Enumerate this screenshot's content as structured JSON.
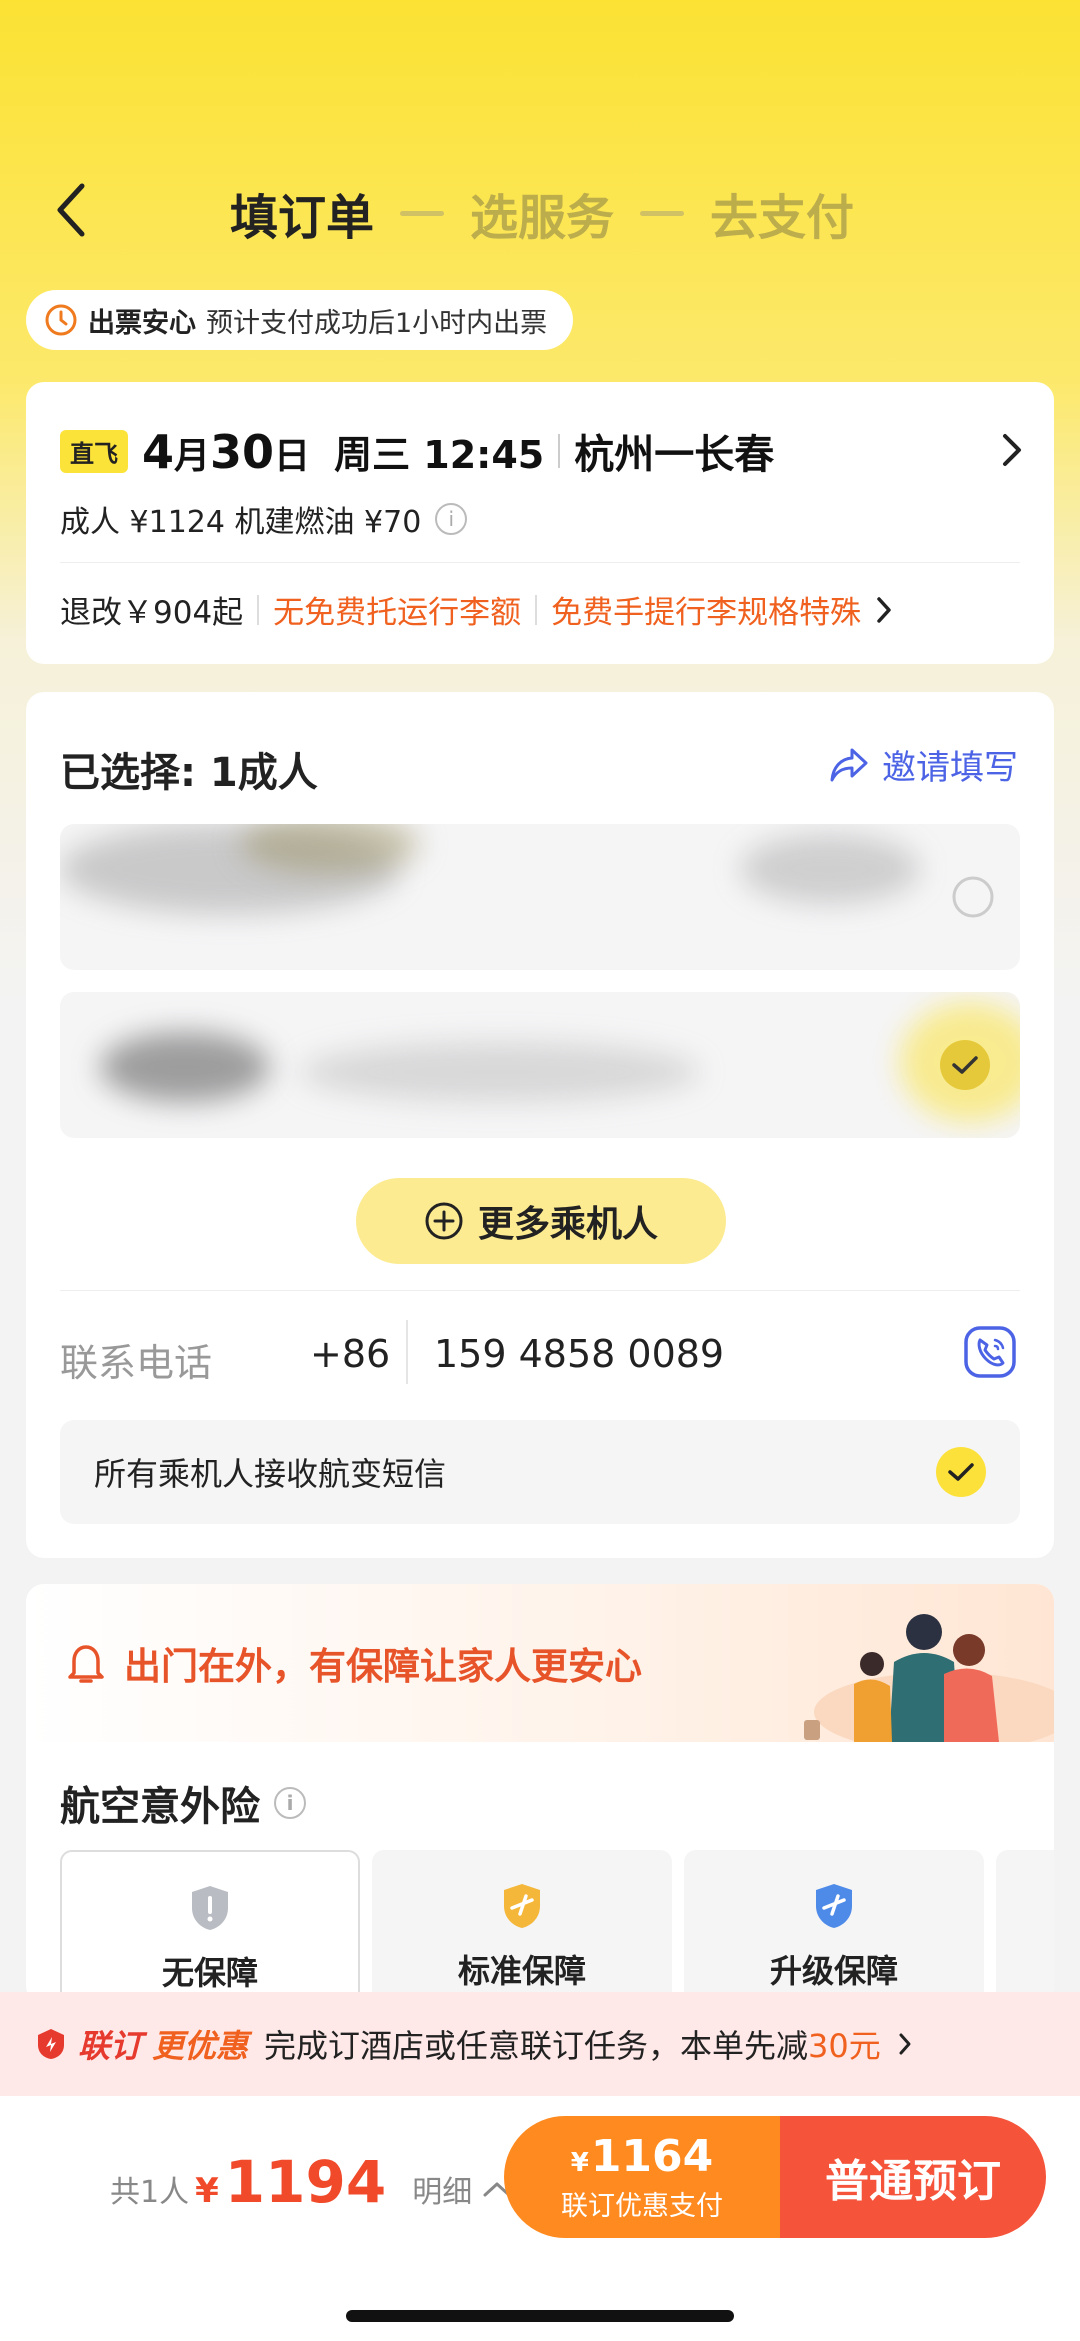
{
  "header": {
    "steps": [
      "填订单",
      "选服务",
      "去支付"
    ]
  },
  "notice": {
    "title": "出票安心",
    "text": "预计支付成功后1小时内出票"
  },
  "flight": {
    "badge": "直飞",
    "month": "4",
    "month_unit": "月",
    "day": "30",
    "day_unit": "日",
    "weekday_time": "周三 12:45",
    "route": "杭州一长春",
    "price_line": "成人 ¥1124 机建燃油 ¥70",
    "policy_refund": "退改￥904起",
    "policy_baggage": "无免费托运行李额",
    "policy_carry": "免费手提行李规格特殊"
  },
  "passengers": {
    "selected": "已选择: 1成人",
    "invite": "邀请填写",
    "more_button": "更多乘机人",
    "phone_label": "联系电话",
    "phone_code": "+86",
    "phone_number": "159 4858 0089",
    "sms_text": "所有乘机人接收航变短信"
  },
  "insurance": {
    "banner": "出门在外，有保障让家人更安心",
    "title": "航空意外险",
    "options": [
      "无保障",
      "标准保障",
      "升级保障"
    ]
  },
  "promo": {
    "brand_a": "联订",
    "brand_b": "更优惠",
    "text": "完成订酒店或任意联订任务，本单先减",
    "amount": "30元"
  },
  "bottom": {
    "count": "共1人",
    "currency": "¥",
    "total": "1194",
    "detail": "明细",
    "bundle_price": "1164",
    "bundle_label": "联订优惠支付",
    "normal_label": "普通预订"
  },
  "colors": {
    "brand_yellow": "#FCE13A",
    "accent_orange": "#F0601E",
    "pay_orange": "#FF8A1F",
    "pay_red": "#F5533A",
    "invite_blue": "#4C63E6"
  }
}
